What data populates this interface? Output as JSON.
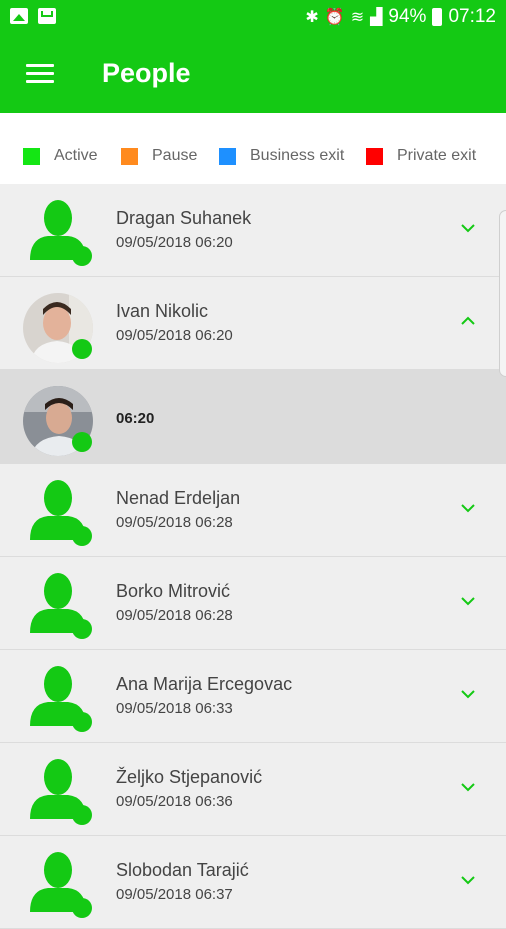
{
  "status_bar": {
    "battery": "94%",
    "time": "07:12",
    "icons": [
      "image-icon",
      "mail-icon",
      "bluetooth-icon",
      "alarm-icon",
      "wifi-icon",
      "signal-icon",
      "battery-icon"
    ]
  },
  "app_bar": {
    "title": "People",
    "menu_icon": "hamburger-menu-icon"
  },
  "legend": [
    {
      "label": "Active",
      "color": "#14e614"
    },
    {
      "label": "Pause",
      "color": "#ff8a1e"
    },
    {
      "label": "Business exit",
      "color": "#1e90ff"
    },
    {
      "label": "Private exit",
      "color": "#ff0000"
    }
  ],
  "people": [
    {
      "name": "Dragan Suhanek",
      "datetime": "09/05/2018 06:20",
      "avatar": "placeholder",
      "expanded": false
    },
    {
      "name": "Ivan Nikolic",
      "datetime": "09/05/2018 06:20",
      "avatar": "photo",
      "expanded": true
    },
    {
      "name": "Nenad Erdeljan",
      "datetime": "09/05/2018 06:28",
      "avatar": "placeholder",
      "expanded": false
    },
    {
      "name": "Borko Mitrović",
      "datetime": "09/05/2018 06:28",
      "avatar": "placeholder",
      "expanded": false
    },
    {
      "name": "Ana Marija Ercegovac",
      "datetime": "09/05/2018 06:33",
      "avatar": "placeholder",
      "expanded": false
    },
    {
      "name": "Željko Stjepanović",
      "datetime": "09/05/2018 06:36",
      "avatar": "placeholder",
      "expanded": false
    },
    {
      "name": "Slobodan Tarajić",
      "datetime": "09/05/2018 06:37",
      "avatar": "placeholder",
      "expanded": false
    }
  ],
  "expanded_entry": {
    "time": "06:20"
  },
  "colors": {
    "brand_green": "#14c914",
    "status_active": "#14c914"
  }
}
